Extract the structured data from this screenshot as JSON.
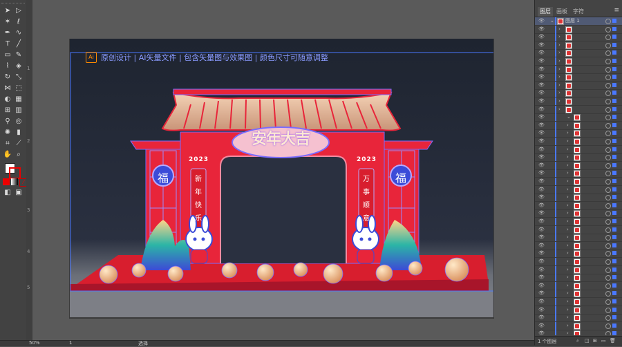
{
  "banner": {
    "ai_label": "Ai",
    "text": "原创设计 | AI矢量文件 | 包含矢量图与效果图 | 颜色尺寸可随意调整"
  },
  "artwork": {
    "door_title": "安年大吉",
    "year_left": "2023",
    "year_right": "2023",
    "couplet_left": "新年快乐",
    "couplet_right": "万事顺意",
    "fu_left": "福",
    "fu_right": "福"
  },
  "ruler": {
    "marks": [
      "1",
      "2",
      "3",
      "4",
      "5"
    ]
  },
  "status": {
    "zoom": "50%",
    "page": "1",
    "mode": "选择"
  },
  "panel": {
    "tabs": [
      "图层",
      "画板",
      "字符"
    ],
    "active_tab": "图层",
    "top_layer": "图层 1",
    "footer": "1 个图层"
  },
  "colors": {
    "accent": "#4a78ff",
    "gate_red": "#e8253a",
    "floor_red": "#d81e2e",
    "roof": "#e6b89a",
    "bg_top": "#1e2430"
  }
}
